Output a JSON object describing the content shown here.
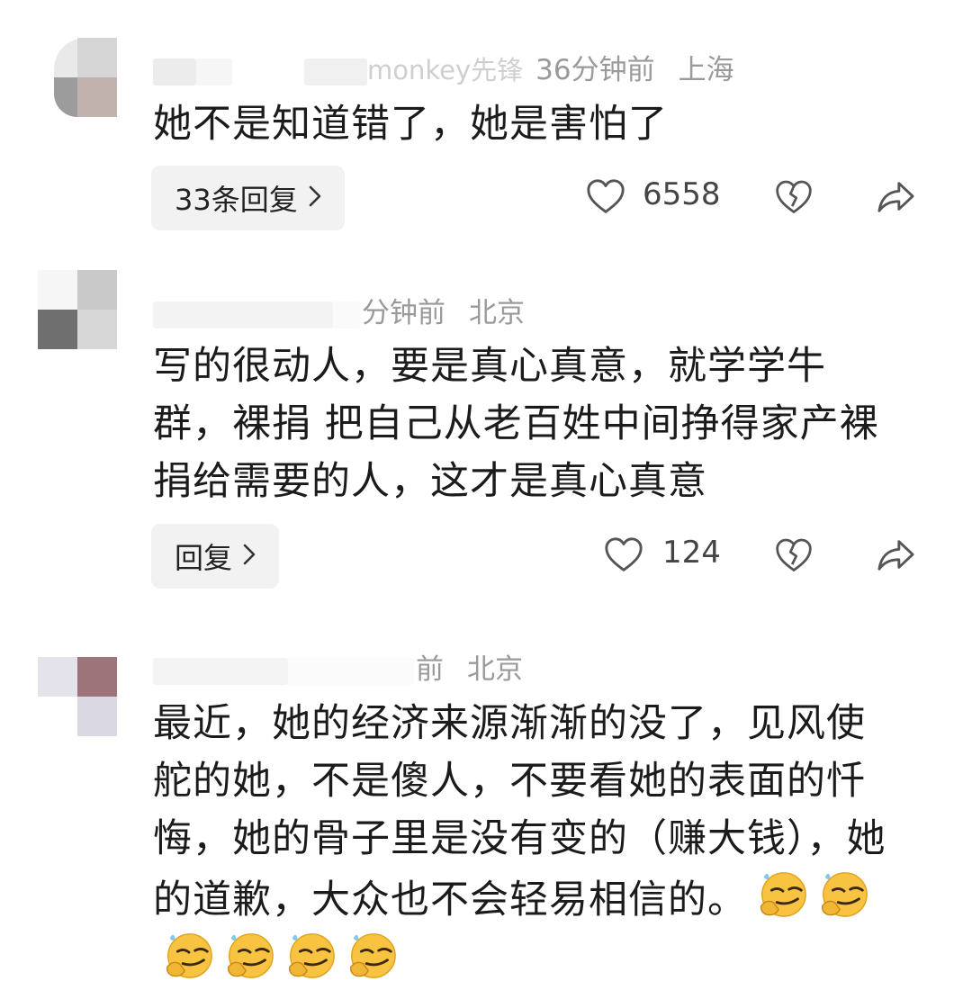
{
  "comments": [
    {
      "username": "monkey先锋",
      "time": "36分钟前",
      "location": "上海",
      "text": "她不是知道错了，她是害怕了",
      "reply_label": "33条回复",
      "likes": "6558"
    },
    {
      "username": "",
      "time": "分钟前",
      "location": "北京",
      "text": "写的很动人，要是真心真意，就学学牛群，裸捐 把自己从老百姓中间挣得家产裸捐给需要的人，这才是真心真意",
      "reply_label": "回复",
      "likes": "124"
    },
    {
      "username": "",
      "time": "前",
      "location": "北京",
      "text": "最近，她的经济来源渐渐的没了，见风使舵的她，不是傻人，不要看她的表面的忏悔，她的骨子里是没有变的（赚大钱），她的道歉，大众也不会轻易相信的。",
      "emoji": "smirk-thinking-emoji",
      "emoji_count": 6
    }
  ],
  "icons": {
    "like": "heart-outline-icon",
    "dislike": "broken-heart-icon",
    "share": "share-arrow-icon",
    "chevron": "chevron-right-icon"
  },
  "colors": {
    "meta": "#9a9a9a",
    "text": "#1b1b1b",
    "button_bg": "#f2f2f2"
  }
}
